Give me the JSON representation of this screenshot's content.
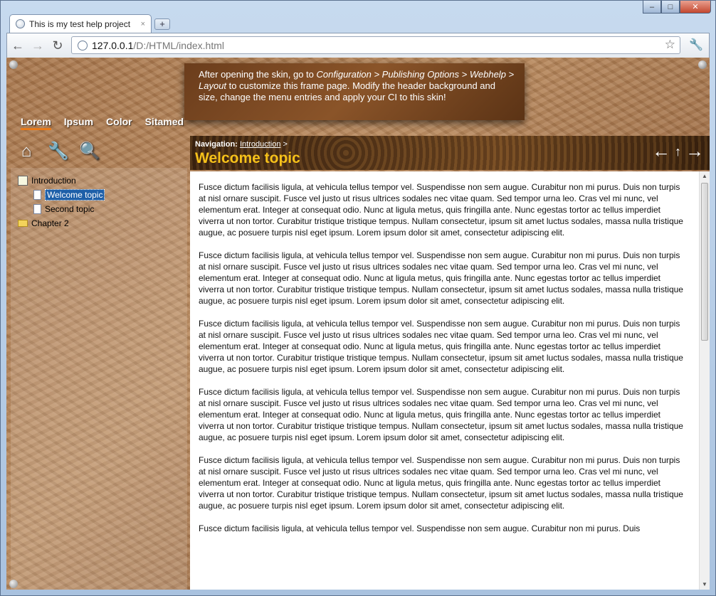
{
  "browser": {
    "tab_title": "This is my test help project",
    "tab_close": "×",
    "new_tab": "+",
    "url_host": "127.0.0.1",
    "url_path": "/D:/HTML/index.html",
    "back": "←",
    "forward": "→",
    "reload": "↻",
    "bookmark": "☆",
    "settings": "🔧",
    "window_min": "–",
    "window_max": "□",
    "window_close": "✕"
  },
  "header": {
    "note_prefix": "After opening the skin, go to ",
    "note_path": "Configuration > Publishing Options > Webhelp > Layout",
    "note_suffix": " to customize this frame page. Modify the header background and size, change the menu entries and apply your CI to this skin!"
  },
  "menu": [
    "Lorem",
    "Ipsum",
    "Color",
    "Sitamed"
  ],
  "tools": {
    "home": "⌂",
    "settings": "🔧",
    "search": "🔍"
  },
  "toc": {
    "chapter1": "Introduction",
    "welcome": "Welcome topic",
    "second": "Second topic",
    "chapter2": "Chapter 2"
  },
  "topic": {
    "nav_label": "Navigation:",
    "nav_link": "Introduction",
    "nav_sep": ">",
    "title": "Welcome topic",
    "prev": "←",
    "up": "↑",
    "next": "→"
  },
  "body": {
    "paragraphs": [
      "Fusce dictum facilisis ligula, at vehicula tellus tempor vel. Suspendisse non sem augue. Curabitur non mi purus. Duis non turpis at nisl ornare suscipit. Fusce vel justo ut risus ultrices sodales nec vitae quam. Sed tempor urna leo. Cras vel mi nunc, vel elementum erat. Integer at consequat odio. Nunc at ligula metus, quis fringilla ante. Nunc egestas tortor ac tellus imperdiet viverra ut non tortor. Curabitur tristique tristique tempus. Nullam consectetur, ipsum sit amet luctus sodales, massa nulla tristique augue, ac posuere turpis nisl eget ipsum. Lorem ipsum dolor sit amet, consectetur adipiscing elit.",
      "Fusce dictum facilisis ligula, at vehicula tellus tempor vel. Suspendisse non sem augue. Curabitur non mi purus. Duis non turpis at nisl ornare suscipit. Fusce vel justo ut risus ultrices sodales nec vitae quam. Sed tempor urna leo. Cras vel mi nunc, vel elementum erat. Integer at consequat odio. Nunc at ligula metus, quis fringilla ante. Nunc egestas tortor ac tellus imperdiet viverra ut non tortor. Curabitur tristique tristique tempus. Nullam consectetur, ipsum sit amet luctus sodales, massa nulla tristique augue, ac posuere turpis nisl eget ipsum. Lorem ipsum dolor sit amet, consectetur adipiscing elit.",
      "Fusce dictum facilisis ligula, at vehicula tellus tempor vel. Suspendisse non sem augue. Curabitur non mi purus. Duis non turpis at nisl ornare suscipit. Fusce vel justo ut risus ultrices sodales nec vitae quam. Sed tempor urna leo. Cras vel mi nunc, vel elementum erat. Integer at consequat odio. Nunc at ligula metus, quis fringilla ante. Nunc egestas tortor ac tellus imperdiet viverra ut non tortor. Curabitur tristique tristique tempus. Nullam consectetur, ipsum sit amet luctus sodales, massa nulla tristique augue, ac posuere turpis nisl eget ipsum. Lorem ipsum dolor sit amet, consectetur adipiscing elit.",
      "Fusce dictum facilisis ligula, at vehicula tellus tempor vel. Suspendisse non sem augue. Curabitur non mi purus. Duis non turpis at nisl ornare suscipit. Fusce vel justo ut risus ultrices sodales nec vitae quam. Sed tempor urna leo. Cras vel mi nunc, vel elementum erat. Integer at consequat odio. Nunc at ligula metus, quis fringilla ante. Nunc egestas tortor ac tellus imperdiet viverra ut non tortor. Curabitur tristique tristique tempus. Nullam consectetur, ipsum sit amet luctus sodales, massa nulla tristique augue, ac posuere turpis nisl eget ipsum. Lorem ipsum dolor sit amet, consectetur adipiscing elit.",
      "Fusce dictum facilisis ligula, at vehicula tellus tempor vel. Suspendisse non sem augue. Curabitur non mi purus. Duis non turpis at nisl ornare suscipit. Fusce vel justo ut risus ultrices sodales nec vitae quam. Sed tempor urna leo. Cras vel mi nunc, vel elementum erat. Integer at consequat odio. Nunc at ligula metus, quis fringilla ante. Nunc egestas tortor ac tellus imperdiet viverra ut non tortor. Curabitur tristique tristique tempus. Nullam consectetur, ipsum sit amet luctus sodales, massa nulla tristique augue, ac posuere turpis nisl eget ipsum. Lorem ipsum dolor sit amet, consectetur adipiscing elit.",
      "Fusce dictum facilisis ligula, at vehicula tellus tempor vel. Suspendisse non sem augue. Curabitur non mi purus. Duis"
    ]
  }
}
